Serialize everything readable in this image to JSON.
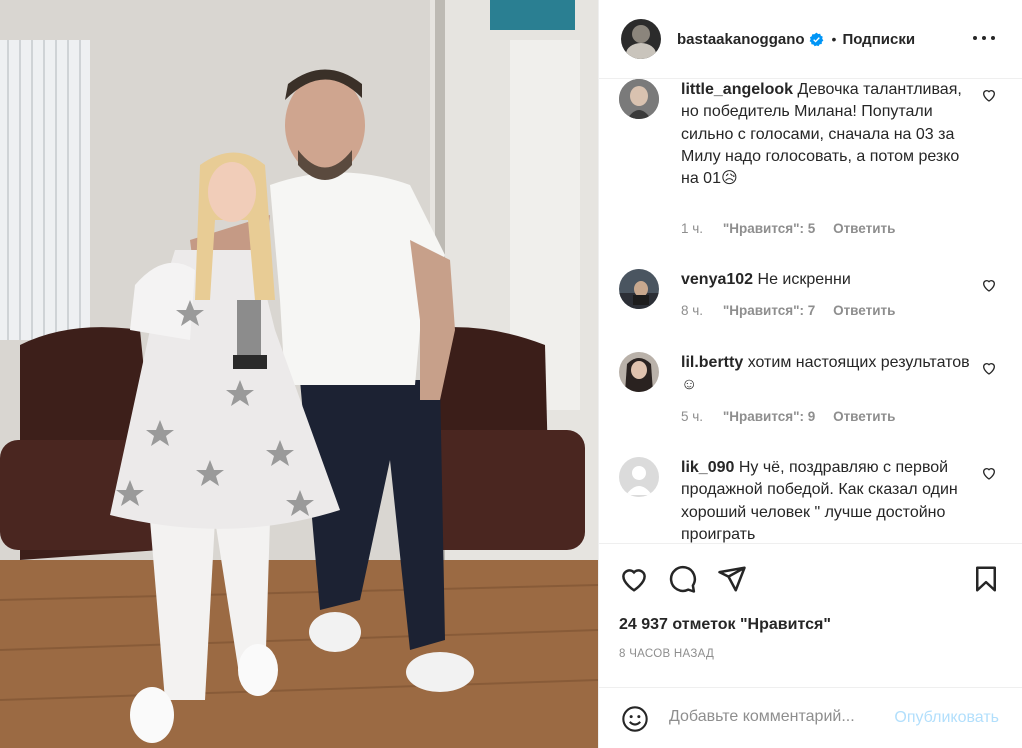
{
  "header": {
    "username": "bastaakanoggano",
    "separator": "•",
    "follow_label": "Подписки"
  },
  "comments": [
    {
      "username": "little_angelook",
      "text": "Девочка талантливая, но победитель Милана! Попутали сильно с голосами, сначала на 03 за Милу надо голосовать, а потом резко на 01😥",
      "time": "1 ч.",
      "likes": "\"Нравится\": 5",
      "reply": "Ответить"
    },
    {
      "username": "venya102",
      "text": "Не искренни",
      "time": "8 ч.",
      "likes": "\"Нравится\": 7",
      "reply": "Ответить"
    },
    {
      "username": "lil.bertty",
      "text": "хотим настоящих результатов ☺",
      "time": "5 ч.",
      "likes": "\"Нравится\": 9",
      "reply": "Ответить"
    },
    {
      "username": "lik_090",
      "text": "Ну чё, поздравляю с первой продажной победой. Как сказал один хороший человек \" лучше достойно проиграть",
      "time": "",
      "likes": "",
      "reply": ""
    }
  ],
  "actions": {
    "likes_count": "24 937 отметок \"Нравится\"",
    "posted_time": "8 ЧАСОВ НАЗАД"
  },
  "add_comment": {
    "placeholder": "Добавьте комментарий...",
    "publish_label": "Опубликовать"
  },
  "icons": {
    "verified": "verified-badge-icon",
    "more": "more-options-icon",
    "like": "heart-icon",
    "comment": "comment-bubble-icon",
    "share": "paper-plane-icon",
    "save": "bookmark-icon",
    "emoji": "emoji-smile-icon"
  },
  "colors": {
    "verified_blue": "#0095f6",
    "publish_disabled": "#b2dffc",
    "secondary_text": "#8e8e8e",
    "primary_text": "#262626"
  }
}
